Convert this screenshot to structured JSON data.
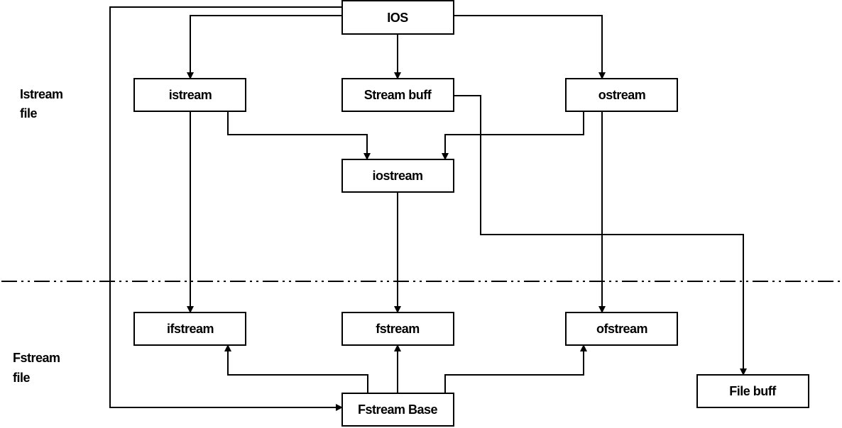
{
  "diagram": {
    "side_labels": {
      "top": [
        "Istream",
        "file"
      ],
      "bottom": [
        "Fstream",
        "file"
      ]
    },
    "nodes": {
      "ios": "IOS",
      "istream": "istream",
      "streambuff": "Stream buff",
      "ostream": "ostream",
      "iostream": "iostream",
      "ifstream": "ifstream",
      "fstream": "fstream",
      "ofstream": "ofstream",
      "filebuff": "File buff",
      "fstreambase": "Fstream Base"
    },
    "edges": [
      [
        "IOS",
        "istream"
      ],
      [
        "IOS",
        "Stream buff"
      ],
      [
        "IOS",
        "ostream"
      ],
      [
        "IOS",
        "Fstream Base"
      ],
      [
        "istream",
        "iostream"
      ],
      [
        "ostream",
        "iostream"
      ],
      [
        "istream",
        "ifstream"
      ],
      [
        "ostream",
        "ofstream"
      ],
      [
        "iostream",
        "fstream"
      ],
      [
        "Stream buff",
        "File buff"
      ],
      [
        "Fstream Base",
        "ifstream"
      ],
      [
        "Fstream Base",
        "fstream"
      ],
      [
        "Fstream Base",
        "ofstream"
      ]
    ]
  }
}
